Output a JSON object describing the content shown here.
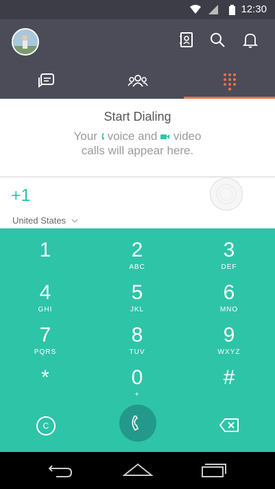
{
  "status_bar": {
    "time": "12:30",
    "icons": [
      "wifi-icon",
      "signal-icon",
      "battery-icon"
    ]
  },
  "app_bar": {
    "actions": [
      "contacts-book-icon",
      "search-icon",
      "bell-icon"
    ]
  },
  "tabs": [
    {
      "name": "messages",
      "icon": "chat-icon",
      "active": false
    },
    {
      "name": "contacts",
      "icon": "people-icon",
      "active": false
    },
    {
      "name": "dialpad",
      "icon": "dialpad-icon",
      "active": true
    }
  ],
  "empty_state": {
    "title": "Start Dialing",
    "line1_part1": "Your ",
    "line1_part2": "voice and ",
    "line1_part3": "video",
    "line2": "calls will appear here."
  },
  "dialer": {
    "number": "+1",
    "country": "United States"
  },
  "keypad": [
    {
      "digit": "1",
      "letters": ""
    },
    {
      "digit": "2",
      "letters": "ABC"
    },
    {
      "digit": "3",
      "letters": "DEF"
    },
    {
      "digit": "4",
      "letters": "GHI"
    },
    {
      "digit": "5",
      "letters": "JKL"
    },
    {
      "digit": "6",
      "letters": "MNO"
    },
    {
      "digit": "7",
      "letters": "PQRS"
    },
    {
      "digit": "8",
      "letters": "TUV"
    },
    {
      "digit": "9",
      "letters": "WXYZ"
    },
    {
      "digit": "*",
      "letters": ""
    },
    {
      "digit": "0",
      "letters": "+"
    },
    {
      "digit": "#",
      "letters": ""
    }
  ],
  "bottom_row": {
    "left_button": "C"
  },
  "colors": {
    "accent": "#2ec4a8",
    "header": "#4b4c58",
    "tab_indicator": "#f0714c"
  }
}
